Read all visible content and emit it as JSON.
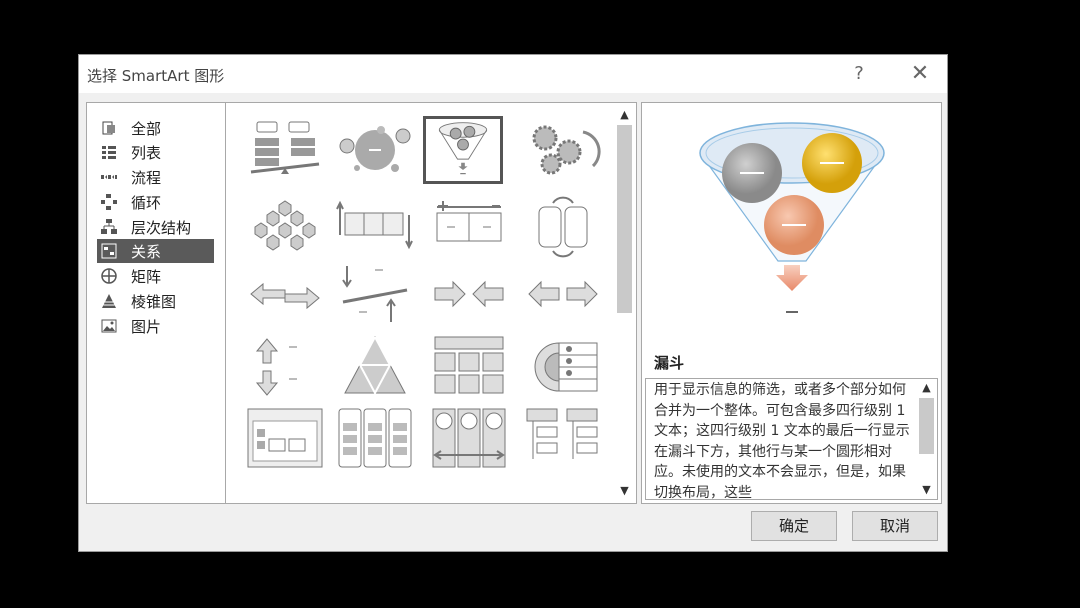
{
  "dialog": {
    "title": "选择 SmartArt 图形",
    "help_glyph": "?",
    "close_glyph": "✕"
  },
  "categories": [
    {
      "label": "全部",
      "icon": "all-icon"
    },
    {
      "label": "列表",
      "icon": "list-icon"
    },
    {
      "label": "流程",
      "icon": "process-icon"
    },
    {
      "label": "循环",
      "icon": "cycle-icon"
    },
    {
      "label": "层次结构",
      "icon": "hierarchy-icon"
    },
    {
      "label": "关系",
      "icon": "relationship-icon",
      "selected": true
    },
    {
      "label": "矩阵",
      "icon": "matrix-icon"
    },
    {
      "label": "棱锥图",
      "icon": "pyramid-icon"
    },
    {
      "label": "图片",
      "icon": "picture-icon"
    }
  ],
  "layouts": {
    "selected": "funnel",
    "items": [
      "balance",
      "circle-relationship",
      "funnel",
      "gears",
      "hexagon-cluster",
      "opposing-arrows-bar",
      "counterbalance",
      "interlocking",
      "arrows-left-right",
      "diverging-offset",
      "converging-arrows",
      "diverging-arrows",
      "up-down-arrows",
      "segmented-pyramid",
      "stacked-tables",
      "nested-targets",
      "grouped-list",
      "table-columns",
      "circle-pillars",
      "hierarchy-list"
    ]
  },
  "preview": {
    "name": "漏斗",
    "description": "用于显示信息的筛选，或者多个部分如何合并为一个整体。可包含最多四行级别 1 文本；这四行级别 1 文本的最后一行显示在漏斗下方，其他行与某一个圆形相对应。未使用的文本不会显示，但是，如果切换布局，这些",
    "colors": {
      "gray": "#9b9b9b",
      "gold": "#e8b20e",
      "orange": "#e8906a",
      "funnel": "#6baed6"
    }
  },
  "buttons": {
    "ok": "确定",
    "cancel": "取消"
  },
  "scroll": {
    "up": "▲",
    "down": "▼"
  }
}
